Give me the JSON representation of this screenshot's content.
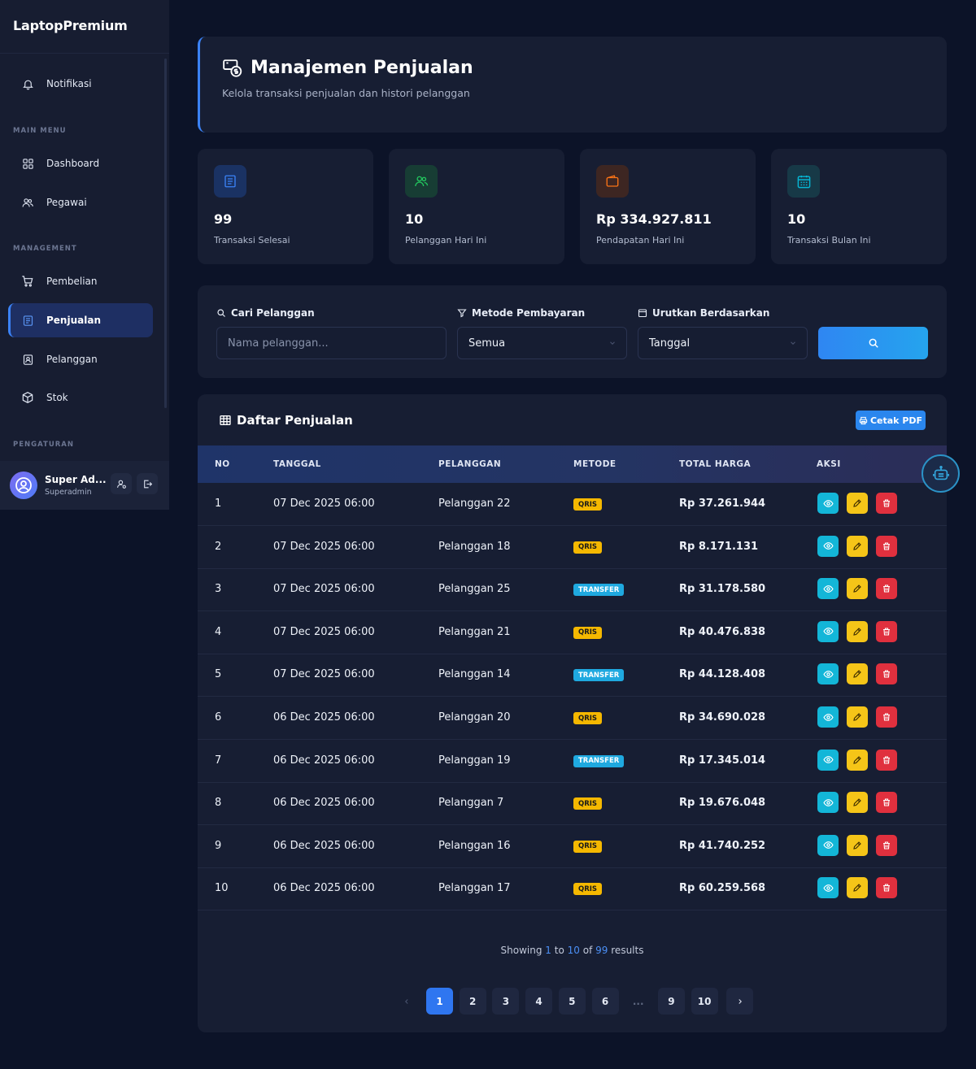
{
  "app": {
    "brand": "LaptopPremium"
  },
  "sidebar": {
    "notification": "Notifikasi",
    "sections": {
      "main": "MAIN MENU",
      "management": "MANAGEMENT",
      "settings": "PENGATURAN"
    },
    "items": [
      {
        "label": "Dashboard",
        "icon": "grid-icon"
      },
      {
        "label": "Pegawai",
        "icon": "users-icon"
      },
      {
        "label": "Pembelian",
        "icon": "cart-icon"
      },
      {
        "label": "Penjualan",
        "icon": "document-icon",
        "active": true
      },
      {
        "label": "Pelanggan",
        "icon": "contact-icon"
      },
      {
        "label": "Stok",
        "icon": "box-icon"
      }
    ],
    "user": {
      "name": "Super Ad...",
      "role": "Superadmin"
    }
  },
  "header": {
    "title": "Manajemen Penjualan",
    "subtitle": "Kelola transaksi penjualan dan histori pelanggan"
  },
  "stats": [
    {
      "value": "99",
      "label": "Transaksi Selesai",
      "color": "#3b82f6"
    },
    {
      "value": "10",
      "label": "Pelanggan Hari Ini",
      "color": "#22c55e"
    },
    {
      "value": "Rp 334.927.811",
      "label": "Pendapatan Hari Ini",
      "color": "#f97316"
    },
    {
      "value": "10",
      "label": "Transaksi Bulan Ini",
      "color": "#06b6d4"
    }
  ],
  "filters": {
    "search_label": "Cari Pelanggan",
    "search_placeholder": "Nama pelanggan...",
    "method_label": "Metode Pembayaran",
    "method_value": "Semua",
    "sort_label": "Urutkan Berdasarkan",
    "sort_value": "Tanggal"
  },
  "table": {
    "title": "Daftar Penjualan",
    "pdf_label": "Cetak PDF",
    "columns": [
      "NO",
      "TANGGAL",
      "PELANGGAN",
      "METODE",
      "TOTAL HARGA",
      "AKSI"
    ],
    "rows": [
      {
        "no": "1",
        "date": "07 Dec 2025 06:00",
        "customer": "Pelanggan 22",
        "method": "QRIS",
        "total": "Rp 37.261.944"
      },
      {
        "no": "2",
        "date": "07 Dec 2025 06:00",
        "customer": "Pelanggan 18",
        "method": "QRIS",
        "total": "Rp 8.171.131"
      },
      {
        "no": "3",
        "date": "07 Dec 2025 06:00",
        "customer": "Pelanggan 25",
        "method": "TRANSFER",
        "total": "Rp 31.178.580"
      },
      {
        "no": "4",
        "date": "07 Dec 2025 06:00",
        "customer": "Pelanggan 21",
        "method": "QRIS",
        "total": "Rp 40.476.838"
      },
      {
        "no": "5",
        "date": "07 Dec 2025 06:00",
        "customer": "Pelanggan 14",
        "method": "TRANSFER",
        "total": "Rp 44.128.408"
      },
      {
        "no": "6",
        "date": "06 Dec 2025 06:00",
        "customer": "Pelanggan 20",
        "method": "QRIS",
        "total": "Rp 34.690.028"
      },
      {
        "no": "7",
        "date": "06 Dec 2025 06:00",
        "customer": "Pelanggan 19",
        "method": "TRANSFER",
        "total": "Rp 17.345.014"
      },
      {
        "no": "8",
        "date": "06 Dec 2025 06:00",
        "customer": "Pelanggan 7",
        "method": "QRIS",
        "total": "Rp 19.676.048"
      },
      {
        "no": "9",
        "date": "06 Dec 2025 06:00",
        "customer": "Pelanggan 16",
        "method": "QRIS",
        "total": "Rp 41.740.252"
      },
      {
        "no": "10",
        "date": "06 Dec 2025 06:00",
        "customer": "Pelanggan 17",
        "method": "QRIS",
        "total": "Rp 60.259.568"
      }
    ]
  },
  "pagination": {
    "showing_prefix": "Showing",
    "from": "1",
    "to_word": "to",
    "to": "10",
    "of_word": "of",
    "total": "99",
    "suffix": "results",
    "pages": [
      "1",
      "2",
      "3",
      "4",
      "5",
      "6",
      "...",
      "9",
      "10"
    ],
    "current": "1"
  }
}
